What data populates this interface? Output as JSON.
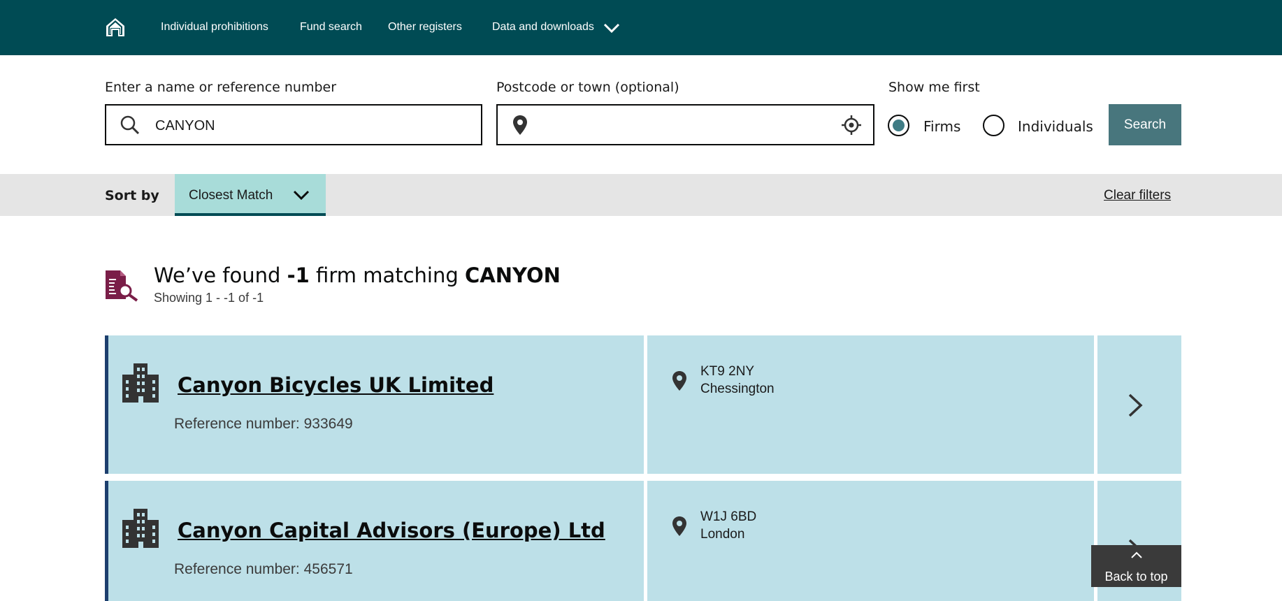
{
  "nav": {
    "items": [
      "Individual prohibitions",
      "Fund search",
      "Other registers",
      "Data and downloads"
    ]
  },
  "search": {
    "name_label": "Enter a name or reference number",
    "name_value": "CANYON",
    "location_label": "Postcode or town (optional)",
    "location_value": "",
    "show_first_label": "Show me first",
    "options": [
      "Firms",
      "Individuals"
    ],
    "selected": "Firms",
    "button_label": "Search"
  },
  "sort": {
    "label": "Sort by",
    "value": "Closest Match",
    "clear_filters": "Clear filters"
  },
  "results": {
    "heading_prefix": "We’ve found ",
    "count": "-1",
    "heading_mid": " firm matching ",
    "query": "CANYON",
    "showing": "Showing 1 - -1 of -1",
    "items": [
      {
        "name": "Canyon Bicycles UK Limited",
        "reference": "Reference number: 933649",
        "postcode": "KT9 2NY",
        "town": "Chessington"
      },
      {
        "name": "Canyon Capital Advisors (Europe) Ltd",
        "reference": "Reference number: 456571",
        "postcode": "W1J 6BD",
        "town": "London"
      }
    ]
  },
  "back_to_top": "Back to top",
  "colors": {
    "nav_bg": "#004b54",
    "search_button": "#48767d",
    "sort_select_bg": "#a8dcd9",
    "card_bg": "#bde0e8",
    "card_accent": "#1d3f6e",
    "results_icon": "#7a1e48"
  }
}
